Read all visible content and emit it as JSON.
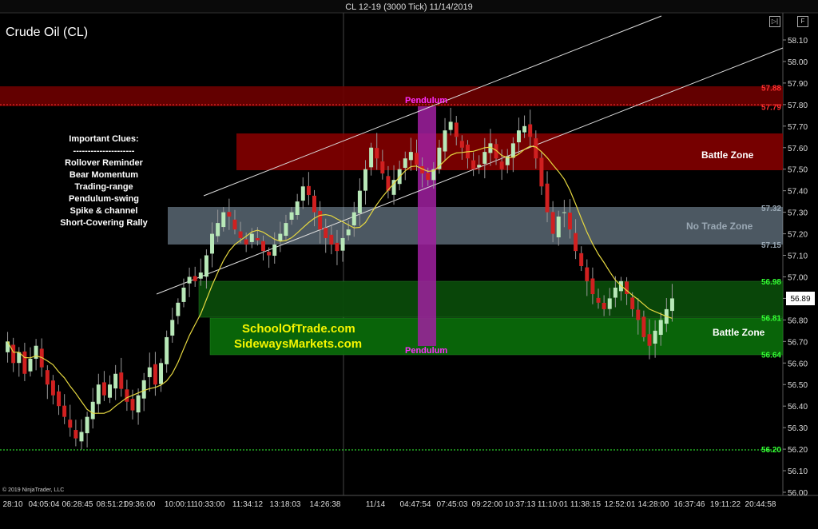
{
  "window": {
    "title": "CL 12-19 (3000 Tick)  11/14/2019"
  },
  "chart_title": "Crude Oil (CL)",
  "copyright": "© 2019 NinjaTrader, LLC",
  "toolbar": {
    "btn1_icon": "play-pause-icon",
    "btn2_label": "F"
  },
  "clues": {
    "heading": "Important Clues:",
    "separator": "---------------------",
    "items": [
      "Rollover Reminder",
      "Bear Momentum",
      "Trading-range",
      "Pendulum-swing",
      "Spike & channel",
      "Short-Covering Rally"
    ]
  },
  "zones": {
    "upper_battle": {
      "label": "Battle Zone",
      "top": 57.65,
      "bottom": 57.49,
      "color": "#8b0000"
    },
    "upper_red": {
      "top": 57.88,
      "bottom": 57.79,
      "color": "#6e0000"
    },
    "no_trade": {
      "label": "No Trade Zone",
      "top": 57.32,
      "bottom": 57.15,
      "color": "#a8c4da"
    },
    "lower_battle": {
      "label": "Battle Zone",
      "upper_top": 56.98,
      "upper_bottom": 56.81,
      "lower_top": 56.81,
      "lower_bottom": 56.64,
      "color": "#0a6a0a"
    }
  },
  "pendulum": {
    "top_label": "Pendulum",
    "bottom_label": "Pendulum"
  },
  "promo": {
    "line1": "SchoolOfTrade.com",
    "line2": "SidewaysMarkets.com"
  },
  "price_levels": [
    {
      "value": "57.88",
      "color": "#ff3030"
    },
    {
      "value": "57.79",
      "color": "#ff3030"
    },
    {
      "value": "57.32",
      "color": "#9aa8b4"
    },
    {
      "value": "57.15",
      "color": "#9aa8b4"
    },
    {
      "value": "56.98",
      "color": "#34ff34"
    },
    {
      "value": "56.81",
      "color": "#34ff34"
    },
    {
      "value": "56.64",
      "color": "#34ff34"
    },
    {
      "value": "56.20",
      "color": "#34ff34"
    }
  ],
  "last_price": "56.89",
  "chart_data": {
    "type": "candlestick",
    "title": "Crude Oil (CL)",
    "ylim": [
      56.0,
      58.2
    ],
    "y_ticks": [
      "58.10",
      "58.00",
      "57.90",
      "57.80",
      "57.70",
      "57.60",
      "57.50",
      "57.40",
      "57.30",
      "57.20",
      "57.10",
      "57.00",
      "56.90",
      "56.80",
      "56.70",
      "56.60",
      "56.50",
      "56.40",
      "56.30",
      "56.20",
      "56.10",
      "56.00"
    ],
    "x_ticks": [
      "28:10",
      "04:05:04",
      "06:28:45",
      "08:51:21",
      "09:36:00",
      "10:00:11",
      "10:33:00",
      "11:34:12",
      "13:18:03",
      "14:26:38",
      "11/14",
      "04:47:54",
      "07:45:03",
      "09:22:00",
      "10:37:13",
      "11:10:01",
      "11:38:15",
      "12:52:01",
      "14:28:00",
      "16:37:46",
      "19:11:22",
      "20:44:58"
    ],
    "closes": [
      56.7,
      56.6,
      56.65,
      56.55,
      56.62,
      56.68,
      56.58,
      56.5,
      56.45,
      56.4,
      56.35,
      56.3,
      56.25,
      56.28,
      56.35,
      56.42,
      56.5,
      56.45,
      56.5,
      56.55,
      56.48,
      56.42,
      56.38,
      56.45,
      56.52,
      56.58,
      56.5,
      56.6,
      56.72,
      56.8,
      56.88,
      56.95,
      57.0,
      56.98,
      57.02,
      57.1,
      57.2,
      57.25,
      57.3,
      57.28,
      57.22,
      57.18,
      57.15,
      57.2,
      57.17,
      57.12,
      57.1,
      57.15,
      57.2,
      57.25,
      57.3,
      57.35,
      57.42,
      57.38,
      57.3,
      57.22,
      57.18,
      57.15,
      57.12,
      57.18,
      57.22,
      57.3,
      57.4,
      57.5,
      57.6,
      57.55,
      57.48,
      57.4,
      57.45,
      57.5,
      57.55,
      57.58,
      57.52,
      57.48,
      57.45,
      57.5,
      57.6,
      57.68,
      57.72,
      57.65,
      57.6,
      57.55,
      57.5,
      57.52,
      57.58,
      57.62,
      57.55,
      57.5,
      57.56,
      57.62,
      57.68,
      57.7,
      57.65,
      57.55,
      57.42,
      57.3,
      57.2,
      57.28,
      57.3,
      57.22,
      57.12,
      57.05,
      56.98,
      56.92,
      56.88,
      56.85,
      56.9,
      56.95,
      56.98,
      56.92,
      56.85,
      56.8,
      56.72,
      56.68,
      56.75,
      56.8,
      56.85,
      56.9
    ]
  }
}
